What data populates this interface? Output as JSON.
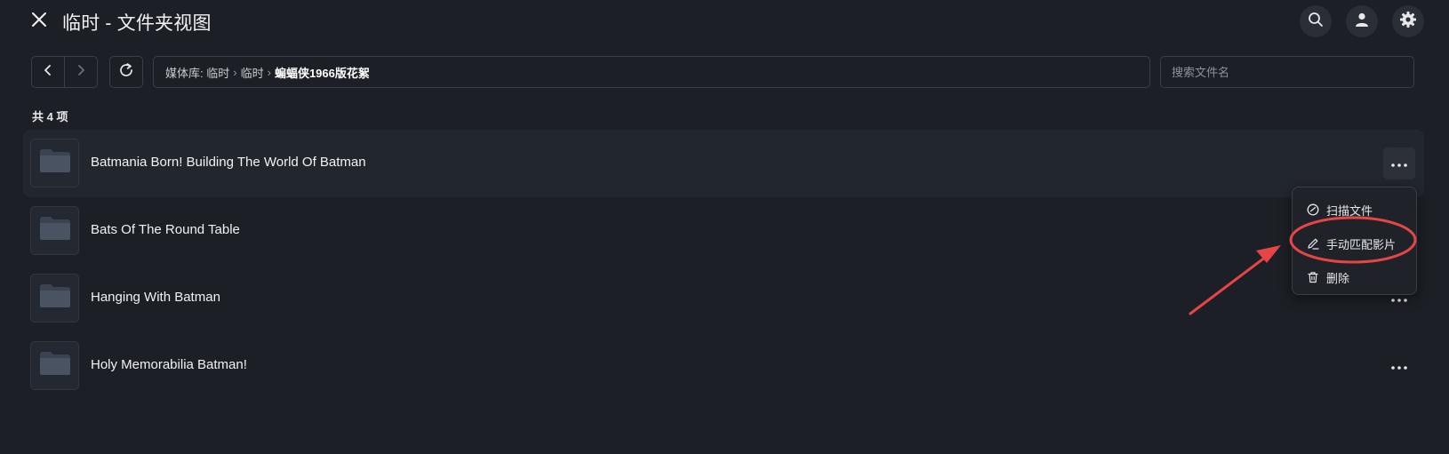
{
  "header": {
    "title": "临时 - 文件夹视图"
  },
  "toolbar": {
    "breadcrumb": [
      {
        "label": "媒体库: 临时"
      },
      {
        "label": "临时"
      },
      {
        "label": "蝙蝠侠1966版花絮"
      }
    ],
    "search_placeholder": "搜索文件名"
  },
  "list": {
    "count_label": "共 4 项",
    "items": [
      {
        "name": "Batmania Born! Building The World Of Batman"
      },
      {
        "name": "Bats Of The Round Table"
      },
      {
        "name": "Hanging With Batman"
      },
      {
        "name": "Holy Memorabilia Batman!"
      }
    ]
  },
  "context_menu": {
    "items": [
      {
        "label": "扫描文件",
        "icon": "scan-icon"
      },
      {
        "label": "手动匹配影片",
        "icon": "edit-pencil-icon"
      },
      {
        "label": "删除",
        "icon": "trash-icon"
      }
    ]
  },
  "annotation": {
    "color": "#e64545"
  }
}
